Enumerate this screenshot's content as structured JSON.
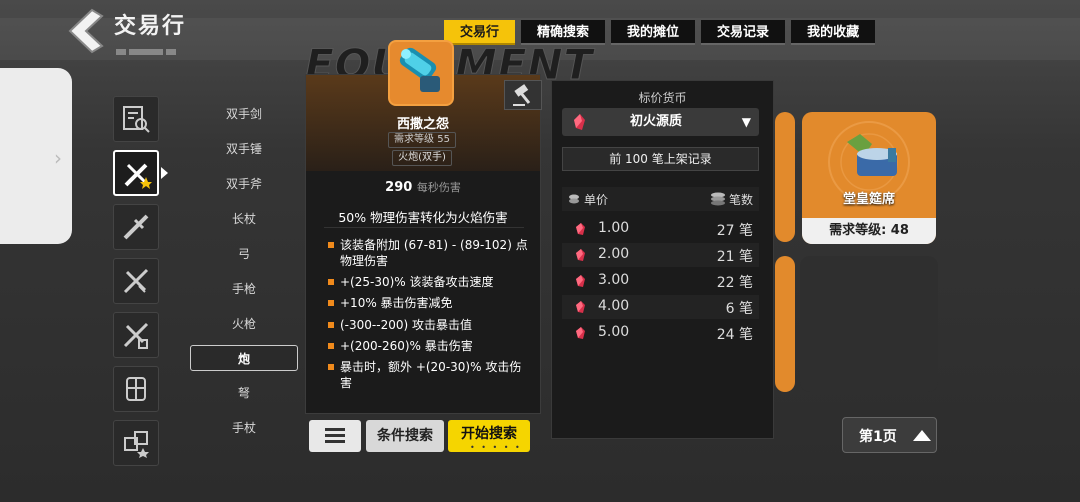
{
  "header": {
    "title": "交易行"
  },
  "tabs": [
    {
      "label": "交易行"
    },
    {
      "label": "精确搜索"
    },
    {
      "label": "我的摊位"
    },
    {
      "label": "交易记录"
    },
    {
      "label": "我的收藏"
    }
  ],
  "background_text": "EQUIPMENT",
  "weapon_types": [
    "双手剑",
    "双手锤",
    "双手斧",
    "长杖",
    "弓",
    "手枪",
    "火枪",
    "炮",
    "弩",
    "手杖"
  ],
  "selected_weapon_type": "炮",
  "tooltip": {
    "item_name": "西撒之怨",
    "required_level": "需求等级 55",
    "item_type": "火炮(双手)",
    "dps_value": "290",
    "dps_unit": "每秒伤害",
    "conversion": "50% 物理伤害转化为火焰伤害",
    "affixes": [
      "该装备附加 (67-81) - (89-102) 点物理伤害",
      "+(25-30)% 该装备攻击速度",
      "+10% 暴击伤害减免",
      "(-300--200) 攻击暴击值",
      "+(200-260)% 暴击伤害",
      "暴击时，额外 +(20-30)% 攻击伤害"
    ]
  },
  "price_panel": {
    "title": "标价货币",
    "currency": "初火源质",
    "records_button": "前 100 笔上架记录",
    "col_price": "单价",
    "col_count": "笔数",
    "rows": [
      {
        "price": "1.00",
        "count": "27 笔"
      },
      {
        "price": "2.00",
        "count": "21 笔"
      },
      {
        "price": "3.00",
        "count": "22 笔"
      },
      {
        "price": "4.00",
        "count": "6 笔"
      },
      {
        "price": "5.00",
        "count": "24 笔"
      }
    ]
  },
  "buttons": {
    "filter": "条件搜索",
    "start_search": "开始搜索",
    "page": "第1页"
  },
  "card": {
    "name": "堂皇筵席",
    "level": "需求等级: 48"
  },
  "colors": {
    "accent_yellow": "#f5c30a",
    "orange": "#e28a2c",
    "affix_bullet": "#f08a1c"
  }
}
